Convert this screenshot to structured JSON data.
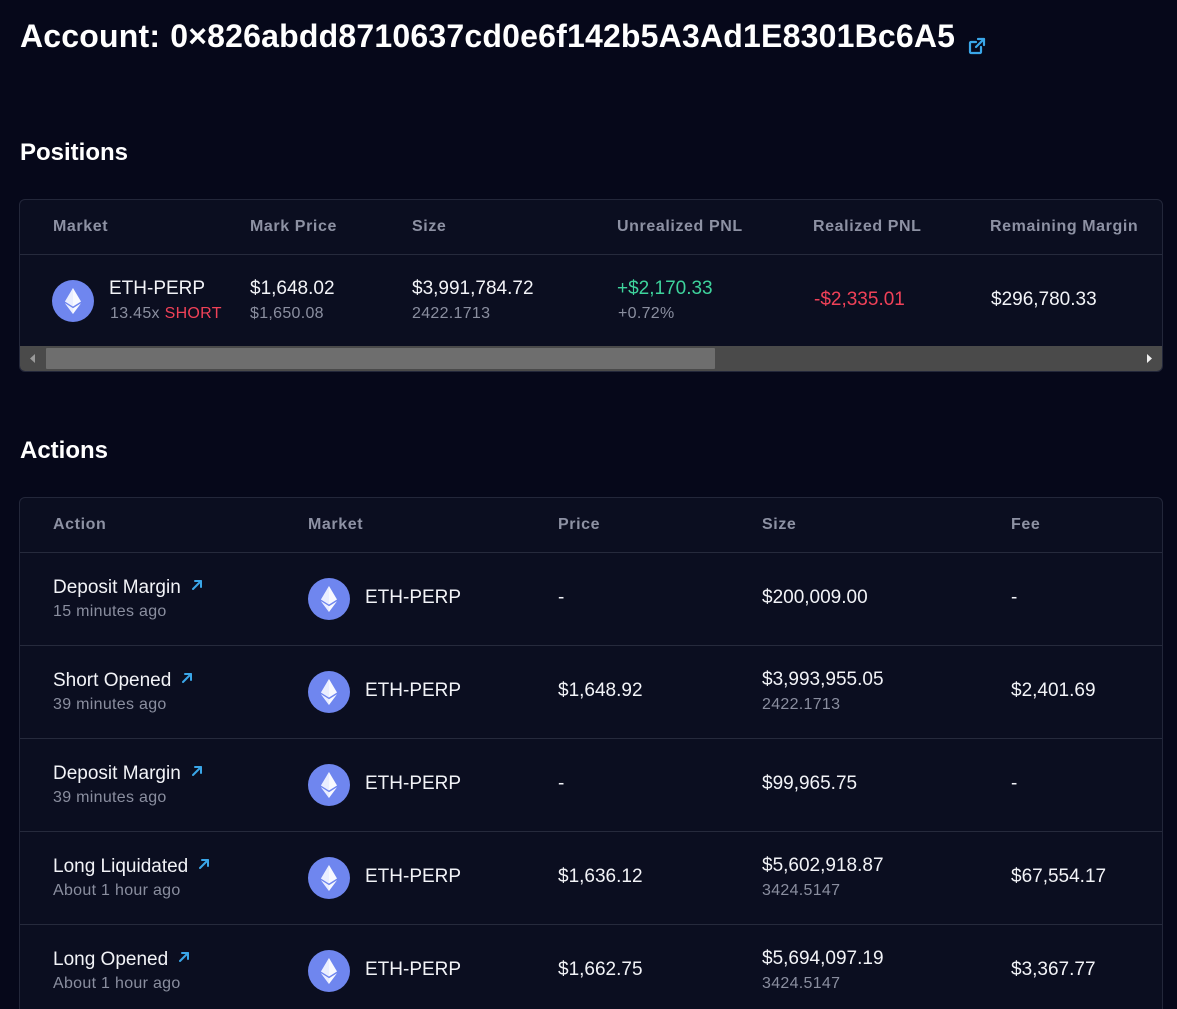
{
  "account": {
    "label": "Account:",
    "address": "0×826abdd8710637cd0e6f142b5A3Ad1E8301Bc6A5",
    "link_icon": "external-link-icon"
  },
  "colors": {
    "background": "#06081a",
    "panel": "#0b0e20",
    "positive": "#3ed39c",
    "negative": "#f04158",
    "accent": "#3aa6e8",
    "eth": "#6f86ef"
  },
  "positions": {
    "title": "Positions",
    "columns": [
      "Market",
      "Mark Price",
      "Size",
      "Unrealized PNL",
      "Realized PNL",
      "Remaining Margin"
    ],
    "rows": [
      {
        "icon": "ethereum-icon",
        "market": "ETH-PERP",
        "leverage": "13.45x",
        "side": "SHORT",
        "mark_price": "$1,648.02",
        "index_price": "$1,650.08",
        "size_usd": "$3,991,784.72",
        "size_units": "2422.1713",
        "unrealized_pnl": "+$2,170.33",
        "unrealized_pnl_pct": "+0.72%",
        "realized_pnl": "-$2,335.01",
        "remaining_margin": "$296,780.33"
      }
    ],
    "scroll_position": 0.6
  },
  "actions": {
    "title": "Actions",
    "columns": [
      "Action",
      "Market",
      "Price",
      "Size",
      "Fee"
    ],
    "rows": [
      {
        "action": "Deposit Margin",
        "time": "15 minutes ago",
        "icon": "ethereum-icon",
        "market": "ETH-PERP",
        "price": "-",
        "size": "$200,009.00",
        "size_units": "",
        "fee": "-"
      },
      {
        "action": "Short Opened",
        "time": "39 minutes ago",
        "icon": "ethereum-icon",
        "market": "ETH-PERP",
        "price": "$1,648.92",
        "size": "$3,993,955.05",
        "size_units": "2422.1713",
        "fee": "$2,401.69"
      },
      {
        "action": "Deposit Margin",
        "time": "39 minutes ago",
        "icon": "ethereum-icon",
        "market": "ETH-PERP",
        "price": "-",
        "size": "$99,965.75",
        "size_units": "",
        "fee": "-"
      },
      {
        "action": "Long Liquidated",
        "time": "About 1 hour ago",
        "icon": "ethereum-icon",
        "market": "ETH-PERP",
        "price": "$1,636.12",
        "size": "$5,602,918.87",
        "size_units": "3424.5147",
        "fee": "$67,554.17"
      },
      {
        "action": "Long Opened",
        "time": "About 1 hour ago",
        "icon": "ethereum-icon",
        "market": "ETH-PERP",
        "price": "$1,662.75",
        "size": "$5,694,097.19",
        "size_units": "3424.5147",
        "fee": "$3,367.77"
      }
    ]
  }
}
